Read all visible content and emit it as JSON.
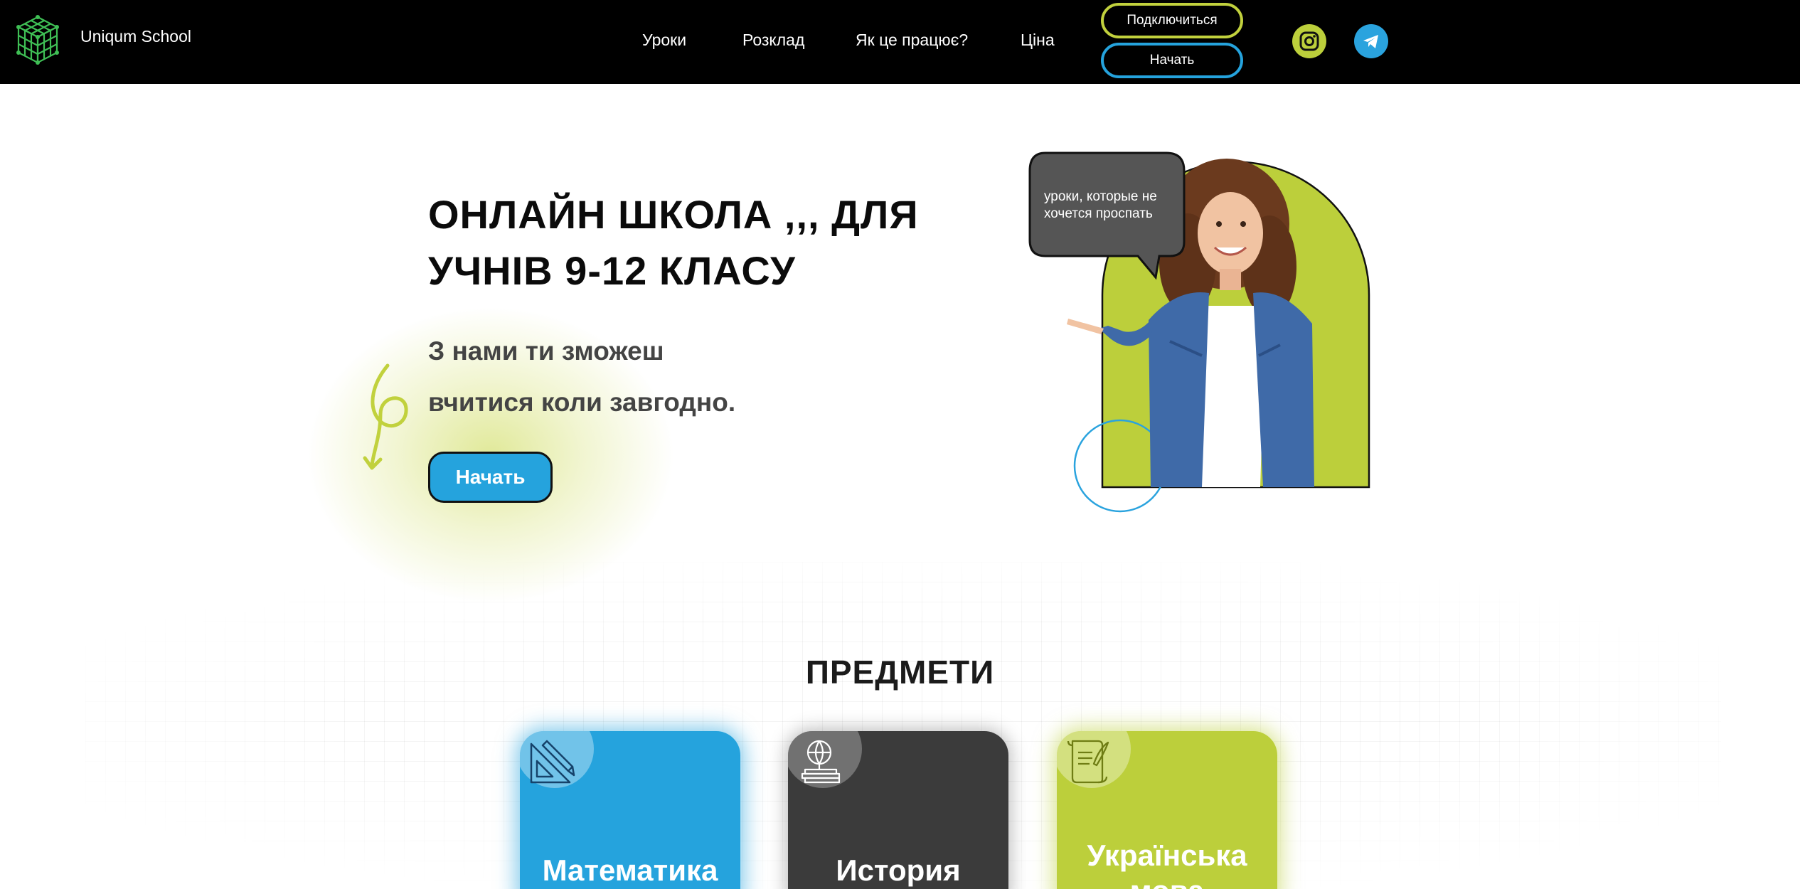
{
  "nav": {
    "brand": "Uniqum School",
    "links": [
      "Уроки",
      "Розклад",
      "Як це працює?",
      "Ціна"
    ],
    "connect_button": "Подключиться",
    "start_button": "Начать",
    "socials": [
      "instagram-icon",
      "telegram-icon"
    ]
  },
  "hero": {
    "title": "ОНЛАЙН ШКОЛА ,,, ДЛЯ УЧНІВ 9-12 КЛАСУ",
    "subtitle_line1": "З нами ти зможеш",
    "subtitle_line2": "вчитися коли завгодно.",
    "cta": "Начать",
    "speech_bubble": [
      "уроки, которые не",
      "хочется проспать"
    ]
  },
  "subjects": {
    "title": "ПРЕДМЕТИ",
    "cards": [
      {
        "label": "Математика",
        "icon": "ruler-triangle-icon",
        "color": "#25a3dd"
      },
      {
        "label": "История",
        "icon": "globe-books-icon",
        "color": "#3b3b3b"
      },
      {
        "label_line1": "Українська",
        "label_line2": "мова",
        "icon": "scroll-quill-icon",
        "color": "#bccf3b"
      }
    ]
  },
  "colors": {
    "accent_blue": "#25a3dd",
    "accent_green": "#bccf3b",
    "dark": "#000000"
  }
}
